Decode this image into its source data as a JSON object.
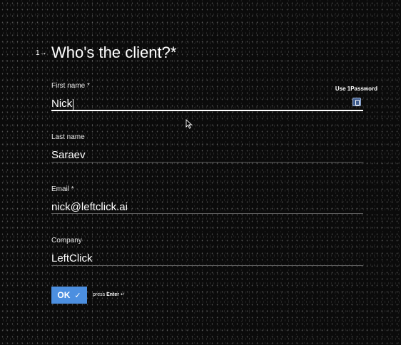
{
  "question": {
    "number": "1",
    "arrow": "→",
    "title": "Who's the client?*"
  },
  "password_manager": {
    "label": "Use 1Password",
    "icon": "1password-icon"
  },
  "fields": {
    "first_name": {
      "label": "First name *",
      "value": "Nick"
    },
    "last_name": {
      "label": "Last name",
      "value": "Saraev"
    },
    "email": {
      "label": "Email *",
      "value": "nick@leftclick.ai"
    },
    "company": {
      "label": "Company",
      "value": "LeftClick"
    }
  },
  "submit": {
    "label": "OK",
    "icon": "check-icon",
    "hint_prefix": "press",
    "hint_key": "Enter",
    "hint_symbol": "↵"
  },
  "colors": {
    "background": "#0b0b0b",
    "accent": "#4c8fe0"
  }
}
